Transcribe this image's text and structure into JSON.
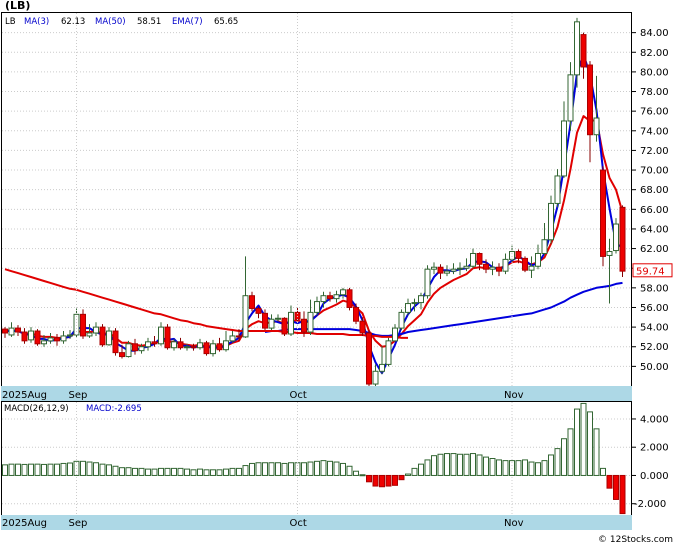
{
  "chart_data": [
    {
      "type": "candlestick",
      "title": "(LB)",
      "indicator_text": {
        "symbol": "LB",
        "ma3": "MA(3)",
        "ma3_value": "62.13",
        "ma50": "MA(50)",
        "ma50_value": "58.51",
        "ema7": "EMA(7)",
        "ema7_value": "65.65"
      },
      "last_price_label": "59.74",
      "y_range": [
        48.0,
        86.0
      ],
      "y_ticks": [
        {
          "v": 50,
          "label": "50.00"
        },
        {
          "v": 52,
          "label": "52.00"
        },
        {
          "v": 54,
          "label": "54.00"
        },
        {
          "v": 56,
          "label": "56.00"
        },
        {
          "v": 58,
          "label": "58.00"
        },
        {
          "v": 60,
          "label": "60.00"
        },
        {
          "v": 62,
          "label": "62.00"
        },
        {
          "v": 64,
          "label": "64.00"
        },
        {
          "v": 66,
          "label": "66.00"
        },
        {
          "v": 68,
          "label": "68.00"
        },
        {
          "v": 70,
          "label": "70.00"
        },
        {
          "v": 72,
          "label": "72.00"
        },
        {
          "v": 74,
          "label": "74.00"
        },
        {
          "v": 76,
          "label": "76.00"
        },
        {
          "v": 78,
          "label": "78.00"
        },
        {
          "v": 80,
          "label": "80.00"
        },
        {
          "v": 82,
          "label": "82.00"
        },
        {
          "v": 84,
          "label": "84.00"
        }
      ],
      "x_labels": [
        {
          "i": 0,
          "label": "2025Aug"
        },
        {
          "i": 11,
          "label": "Sep"
        },
        {
          "i": 45,
          "label": "Oct"
        },
        {
          "i": 78,
          "label": "Nov"
        }
      ],
      "candles": [
        [
          53.8,
          53.4,
          54.0,
          52.9
        ],
        [
          53.2,
          53.9,
          54.5,
          53.0
        ],
        [
          53.9,
          53.5,
          54.2,
          53.1
        ],
        [
          53.5,
          52.6,
          53.9,
          52.3
        ],
        [
          52.7,
          53.6,
          54.0,
          52.4
        ],
        [
          53.6,
          52.3,
          53.8,
          52.1
        ],
        [
          52.3,
          52.6,
          53.2,
          52.0
        ],
        [
          52.6,
          52.9,
          53.4,
          52.3
        ],
        [
          52.9,
          52.6,
          53.3,
          52.1
        ],
        [
          52.6,
          53.1,
          53.6,
          52.3
        ],
        [
          53.1,
          53.2,
          53.7,
          52.8
        ],
        [
          53.2,
          55.3,
          55.9,
          52.9
        ],
        [
          55.3,
          53.1,
          55.8,
          52.8
        ],
        [
          53.1,
          53.4,
          54.3,
          52.9
        ],
        [
          53.4,
          54.0,
          54.5,
          53.1
        ],
        [
          54.0,
          52.2,
          54.3,
          52.0
        ],
        [
          52.2,
          53.6,
          54.0,
          52.1
        ],
        [
          53.6,
          51.4,
          53.9,
          51.1
        ],
        [
          51.4,
          51.0,
          52.2,
          50.8
        ],
        [
          51.0,
          52.3,
          52.6,
          50.9
        ],
        [
          52.3,
          51.6,
          52.8,
          51.2
        ],
        [
          51.6,
          52.0,
          52.3,
          51.3
        ],
        [
          52.0,
          52.5,
          52.9,
          51.6
        ],
        [
          52.5,
          52.3,
          53.1,
          52.0
        ],
        [
          52.3,
          54.0,
          54.5,
          52.1
        ],
        [
          54.0,
          51.9,
          54.3,
          51.7
        ],
        [
          51.9,
          52.5,
          52.8,
          51.6
        ],
        [
          52.5,
          51.9,
          52.9,
          51.7
        ],
        [
          51.9,
          52.0,
          52.3,
          51.6
        ],
        [
          52.0,
          51.9,
          52.3,
          51.6
        ],
        [
          51.9,
          52.4,
          52.8,
          51.7
        ],
        [
          52.4,
          51.3,
          52.6,
          51.1
        ],
        [
          51.3,
          52.3,
          52.7,
          51.0
        ],
        [
          52.3,
          51.7,
          52.9,
          51.5
        ],
        [
          51.7,
          52.6,
          53.6,
          51.5
        ],
        [
          52.6,
          53.1,
          53.6,
          52.4
        ],
        [
          53.1,
          53.0,
          53.8,
          52.6
        ],
        [
          53.0,
          57.2,
          61.2,
          52.9
        ],
        [
          57.2,
          55.9,
          57.6,
          55.6
        ],
        [
          55.9,
          55.4,
          56.1,
          54.9
        ],
        [
          55.4,
          53.9,
          55.8,
          53.7
        ],
        [
          53.9,
          54.8,
          55.3,
          53.7
        ],
        [
          54.8,
          54.9,
          55.3,
          54.6
        ],
        [
          54.9,
          53.3,
          55.0,
          53.1
        ],
        [
          53.3,
          55.5,
          56.2,
          53.1
        ],
        [
          55.5,
          54.8,
          56.0,
          54.6
        ],
        [
          54.8,
          53.5,
          55.6,
          53.0
        ],
        [
          53.5,
          55.5,
          56.8,
          53.2
        ],
        [
          55.5,
          56.6,
          57.1,
          55.2
        ],
        [
          56.6,
          57.2,
          57.6,
          56.0
        ],
        [
          57.2,
          56.9,
          57.6,
          56.6
        ],
        [
          56.9,
          57.3,
          57.7,
          56.5
        ],
        [
          57.3,
          57.8,
          58.0,
          56.9
        ],
        [
          57.8,
          56.0,
          58.0,
          55.7
        ],
        [
          56.0,
          54.6,
          56.4,
          54.3
        ],
        [
          54.6,
          53.4,
          55.0,
          53.1
        ],
        [
          53.4,
          48.2,
          53.7,
          48.0
        ],
        [
          48.2,
          49.5,
          50.2,
          48.0
        ],
        [
          49.5,
          50.2,
          52.1,
          49.2
        ],
        [
          50.2,
          52.6,
          52.9,
          50.0
        ],
        [
          52.6,
          53.9,
          54.3,
          52.5
        ],
        [
          53.9,
          55.5,
          55.8,
          53.7
        ],
        [
          55.5,
          56.4,
          56.9,
          55.2
        ],
        [
          56.4,
          56.5,
          56.9,
          55.6
        ],
        [
          56.5,
          57.2,
          57.5,
          55.8
        ],
        [
          57.2,
          59.9,
          60.3,
          56.9
        ],
        [
          59.9,
          60.1,
          60.6,
          59.4
        ],
        [
          60.1,
          59.5,
          60.4,
          58.9
        ],
        [
          59.5,
          59.7,
          60.3,
          59.2
        ],
        [
          59.7,
          59.9,
          60.5,
          59.4
        ],
        [
          59.9,
          60.0,
          60.6,
          59.3
        ],
        [
          60.0,
          60.2,
          61.0,
          59.7
        ],
        [
          60.2,
          61.5,
          62.0,
          60.0
        ],
        [
          61.5,
          60.4,
          61.6,
          59.8
        ],
        [
          60.4,
          59.9,
          60.9,
          59.5
        ],
        [
          59.9,
          60.1,
          60.7,
          59.3
        ],
        [
          60.1,
          59.7,
          60.5,
          59.2
        ],
        [
          59.7,
          60.9,
          61.5,
          59.4
        ],
        [
          60.9,
          61.7,
          62.3,
          60.6
        ],
        [
          61.7,
          61.0,
          61.9,
          60.5
        ],
        [
          61.0,
          59.8,
          61.2,
          59.6
        ],
        [
          59.8,
          60.2,
          61.2,
          59.0
        ],
        [
          60.2,
          61.5,
          62.4,
          59.9
        ],
        [
          61.5,
          62.9,
          64.6,
          61.3
        ],
        [
          62.9,
          66.6,
          67.4,
          62.5
        ],
        [
          66.6,
          69.4,
          70.1,
          66.2
        ],
        [
          69.4,
          75.0,
          77.0,
          69.2
        ],
        [
          75.0,
          79.7,
          81.0,
          74.0
        ],
        [
          79.7,
          85.1,
          85.5,
          78.4
        ],
        [
          83.8,
          80.5,
          84.0,
          79.3
        ],
        [
          80.7,
          73.6,
          81.1,
          70.8
        ],
        [
          73.6,
          75.3,
          79.6,
          72.9
        ],
        [
          70.0,
          61.2,
          70.4,
          60.2
        ],
        [
          61.3,
          61.7,
          63.0,
          56.4
        ],
        [
          61.8,
          64.5,
          65.1,
          61.5
        ],
        [
          66.2,
          59.7,
          66.4,
          59.1
        ]
      ],
      "series": [
        {
          "name": "EMA(7)",
          "color": "#e00000",
          "values": [
            53.6,
            53.7,
            53.6,
            53.3,
            53.4,
            53.1,
            53.0,
            53.0,
            52.9,
            52.9,
            53.0,
            53.6,
            53.5,
            53.5,
            53.6,
            53.3,
            53.4,
            52.9,
            52.4,
            52.4,
            52.2,
            52.1,
            52.2,
            52.3,
            52.7,
            52.5,
            52.5,
            52.3,
            52.2,
            52.1,
            52.2,
            52.0,
            52.1,
            52.0,
            52.1,
            52.4,
            52.6,
            53.8,
            54.3,
            54.6,
            54.4,
            54.5,
            54.6,
            54.3,
            54.6,
            54.7,
            54.4,
            54.7,
            55.2,
            55.7,
            56.0,
            56.3,
            56.7,
            56.5,
            56.0,
            55.4,
            53.6,
            52.6,
            52.0,
            52.1,
            52.6,
            53.3,
            54.1,
            54.7,
            55.3,
            56.5,
            57.4,
            58.0,
            58.4,
            58.8,
            59.1,
            59.4,
            60.0,
            60.1,
            60.0,
            60.0,
            60.0,
            60.2,
            60.6,
            60.7,
            60.5,
            60.4,
            60.6,
            61.1,
            62.5,
            64.2,
            66.9,
            70.1,
            73.8,
            75.5,
            75.0,
            75.1,
            71.6,
            69.2,
            68.0,
            65.7
          ]
        },
        {
          "name": "MA(3)",
          "color": "#0000dd",
          "values": [
            53.6,
            53.6,
            53.6,
            53.3,
            53.2,
            52.8,
            52.8,
            52.6,
            52.7,
            52.9,
            53.0,
            53.9,
            53.9,
            53.9,
            53.5,
            53.2,
            53.3,
            52.4,
            52.0,
            51.6,
            51.6,
            51.9,
            52.0,
            52.3,
            52.9,
            52.7,
            52.8,
            52.1,
            52.1,
            51.9,
            52.1,
            51.9,
            52.0,
            51.8,
            52.2,
            52.5,
            52.9,
            54.4,
            55.4,
            56.2,
            55.1,
            54.7,
            54.5,
            54.3,
            54.6,
            54.4,
            54.6,
            54.6,
            55.2,
            56.4,
            56.9,
            57.1,
            57.3,
            57.0,
            56.1,
            54.7,
            52.1,
            50.4,
            49.3,
            50.8,
            52.2,
            54.0,
            55.3,
            56.1,
            56.7,
            57.9,
            59.1,
            59.8,
            59.8,
            59.7,
            59.9,
            60.0,
            60.6,
            60.7,
            60.6,
            60.1,
            59.9,
            60.2,
            60.8,
            61.2,
            60.8,
            60.3,
            60.5,
            61.5,
            63.7,
            66.3,
            70.3,
            74.7,
            79.9,
            81.8,
            79.7,
            76.1,
            70.0,
            66.1,
            62.5,
            62.1
          ]
        },
        {
          "name": "MA(50)",
          "color": "#0000dd",
          "values": [
            null,
            null,
            null,
            null,
            null,
            null,
            null,
            null,
            null,
            null,
            null,
            null,
            null,
            null,
            null,
            null,
            null,
            null,
            null,
            null,
            null,
            null,
            null,
            null,
            null,
            null,
            null,
            null,
            null,
            null,
            null,
            null,
            null,
            null,
            null,
            null,
            null,
            null,
            null,
            null,
            53.5,
            53.6,
            53.6,
            53.7,
            53.8,
            53.8,
            53.8,
            53.8,
            53.8,
            53.8,
            53.8,
            53.8,
            53.8,
            53.8,
            53.7,
            53.6,
            53.4,
            53.2,
            53.1,
            53.1,
            53.2,
            53.3,
            53.5,
            53.6,
            53.7,
            53.8,
            53.9,
            54.0,
            54.1,
            54.2,
            54.3,
            54.4,
            54.5,
            54.6,
            54.7,
            54.8,
            54.9,
            55.0,
            55.1,
            55.2,
            55.3,
            55.4,
            55.6,
            55.8,
            56.0,
            56.3,
            56.6,
            57.0,
            57.3,
            57.6,
            57.8,
            58.0,
            58.1,
            58.2,
            58.4,
            58.5
          ]
        },
        {
          "name": "MA(200)",
          "color": "#e00000",
          "values": [
            59.9,
            59.7,
            59.5,
            59.3,
            59.1,
            58.9,
            58.7,
            58.5,
            58.3,
            58.1,
            57.9,
            57.8,
            57.6,
            57.4,
            57.2,
            57.0,
            56.8,
            56.6,
            56.4,
            56.2,
            56.0,
            55.8,
            55.6,
            55.4,
            55.3,
            55.1,
            54.9,
            54.7,
            54.6,
            54.4,
            54.3,
            54.1,
            54.0,
            53.9,
            53.8,
            53.7,
            53.6,
            53.6,
            53.6,
            53.6,
            53.6,
            53.6,
            53.6,
            53.5,
            53.5,
            53.4,
            53.4,
            53.4,
            53.3,
            53.3,
            53.3,
            53.3,
            53.3,
            53.2,
            53.2,
            53.2,
            53.1,
            53.1,
            53.0,
            53.0,
            53.0,
            52.9,
            52.9,
            null,
            null,
            null,
            null,
            null,
            null,
            null,
            null,
            null,
            null,
            null,
            null,
            null,
            null,
            null,
            null,
            null,
            null,
            null,
            null,
            null,
            null,
            null,
            null,
            null,
            null,
            null,
            null,
            null,
            null,
            null,
            null,
            null
          ]
        }
      ]
    },
    {
      "type": "bar",
      "title": "MACD(26,12,9)",
      "value_label": "MACD:-2.695",
      "y_range": [
        -2.8,
        5.2
      ],
      "y_ticks": [
        {
          "v": 4,
          "label": "4.000"
        },
        {
          "v": 2,
          "label": "2.000"
        },
        {
          "v": 0,
          "label": "0.000"
        },
        {
          "v": -2,
          "label": "-2.000"
        }
      ],
      "x_labels": [
        {
          "i": 0,
          "label": "2025Aug"
        },
        {
          "i": 11,
          "label": "Sep"
        },
        {
          "i": 45,
          "label": "Oct"
        },
        {
          "i": 78,
          "label": "Nov"
        }
      ],
      "values": [
        0.75,
        0.8,
        0.8,
        0.78,
        0.8,
        0.8,
        0.78,
        0.8,
        0.8,
        0.85,
        0.88,
        1.0,
        1.0,
        0.95,
        0.9,
        0.8,
        0.75,
        0.65,
        0.55,
        0.55,
        0.5,
        0.5,
        0.45,
        0.45,
        0.5,
        0.5,
        0.5,
        0.5,
        0.45,
        0.4,
        0.45,
        0.4,
        0.4,
        0.4,
        0.45,
        0.5,
        0.5,
        0.7,
        0.85,
        0.9,
        0.9,
        0.9,
        0.9,
        0.85,
        0.9,
        0.9,
        0.9,
        0.95,
        1.0,
        1.05,
        1.0,
        0.95,
        0.85,
        0.65,
        0.3,
        0.05,
        -0.45,
        -0.75,
        -0.8,
        -0.75,
        -0.7,
        -0.3,
        0.1,
        0.5,
        0.8,
        1.1,
        1.4,
        1.5,
        1.55,
        1.55,
        1.5,
        1.5,
        1.55,
        1.45,
        1.3,
        1.2,
        1.1,
        1.05,
        1.05,
        1.05,
        1.1,
        0.95,
        0.9,
        1.05,
        1.45,
        1.9,
        2.6,
        3.3,
        4.7,
        5.1,
        4.5,
        3.3,
        0.5,
        -0.9,
        -1.7,
        -2.7
      ]
    }
  ],
  "footer": "© 12Stocks.com"
}
